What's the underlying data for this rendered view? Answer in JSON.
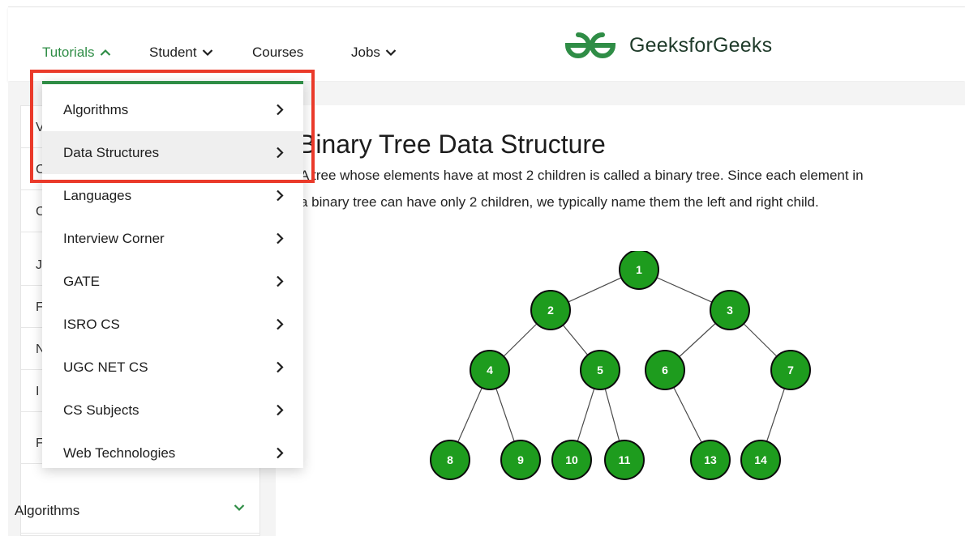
{
  "header": {
    "nav": [
      {
        "label": "Tutorials",
        "active": true,
        "chevron": "chevron-up-icon"
      },
      {
        "label": "Student",
        "active": false,
        "chevron": "chevron-down-icon"
      },
      {
        "label": "Courses",
        "active": false,
        "chevron": ""
      },
      {
        "label": "Jobs",
        "active": false,
        "chevron": "chevron-down-icon"
      }
    ],
    "logo_text": "GeeksforGeeks",
    "brand_color": "#2f8d46"
  },
  "dropdown": {
    "items": [
      {
        "label": "Algorithms",
        "hover": false
      },
      {
        "label": "Data Structures",
        "hover": true
      },
      {
        "label": "Languages",
        "hover": false
      },
      {
        "label": "Interview Corner",
        "hover": false
      },
      {
        "label": "GATE",
        "hover": false
      },
      {
        "label": "ISRO CS",
        "hover": false
      },
      {
        "label": "UGC NET CS",
        "hover": false
      },
      {
        "label": "CS Subjects",
        "hover": false
      },
      {
        "label": "Web Technologies",
        "hover": false
      }
    ],
    "highlight_color": "#ea3a2a"
  },
  "sidebar": {
    "peek_letters": [
      "V",
      "C",
      "C",
      "J",
      "F",
      "N",
      "I",
      "F"
    ],
    "algorithms_label": "Algorithms"
  },
  "article": {
    "title": "Binary Tree Data Structure",
    "line1": "A tree whose elements have at most 2 children is called a binary tree. Since each element in",
    "line2": "a binary tree can have only 2 children, we typically name them the left and right child."
  },
  "tree": {
    "node_color": "#1e9c1e",
    "nodes": [
      {
        "label": "1",
        "parent": null
      },
      {
        "label": "2",
        "parent": "1"
      },
      {
        "label": "3",
        "parent": "1"
      },
      {
        "label": "4",
        "parent": "2"
      },
      {
        "label": "5",
        "parent": "2"
      },
      {
        "label": "6",
        "parent": "3"
      },
      {
        "label": "7",
        "parent": "3"
      },
      {
        "label": "8",
        "parent": "4"
      },
      {
        "label": "9",
        "parent": "4"
      },
      {
        "label": "10",
        "parent": "5"
      },
      {
        "label": "11",
        "parent": "5"
      },
      {
        "label": "13",
        "parent": "6"
      },
      {
        "label": "14",
        "parent": "7"
      }
    ]
  }
}
